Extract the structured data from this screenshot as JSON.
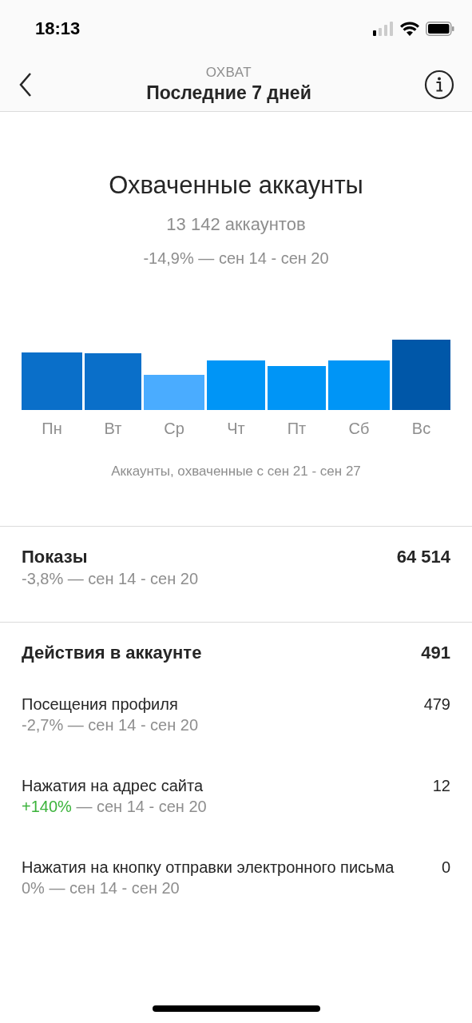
{
  "status_bar": {
    "time": "18:13"
  },
  "header": {
    "overline": "ОХВАТ",
    "title": "Последние 7 дней"
  },
  "reach": {
    "title": "Охваченные аккаунты",
    "count": "13 142 аккаунтов",
    "change": "-14,9%",
    "period": "— сен 14 - сен 20",
    "chart": {
      "day_labels": [
        "Пн",
        "Вт",
        "Ср",
        "Чт",
        "Пт",
        "Сб",
        "Вс"
      ],
      "caption": "Аккаунты, охваченные с сен 21 - сен 27"
    }
  },
  "impressions": {
    "label": "Показы",
    "value": "64 514",
    "change": "-3,8%",
    "positive": false,
    "period": "— сен 14 - сен 20"
  },
  "actions": {
    "label": "Действия в аккаунте",
    "value": "491",
    "items": [
      {
        "label": "Посещения профиля",
        "value": "479",
        "change": "-2,7%",
        "positive": false,
        "period": "— сен 14 - сен 20"
      },
      {
        "label": "Нажатия на адрес сайта",
        "value": "12",
        "change": "+140%",
        "positive": true,
        "period": "— сен 14 - сен 20"
      },
      {
        "label": "Нажатия на кнопку отправки электронного письма",
        "value": "0",
        "change": "0%",
        "positive": false,
        "period": "— сен 14 - сен 20"
      }
    ]
  }
}
